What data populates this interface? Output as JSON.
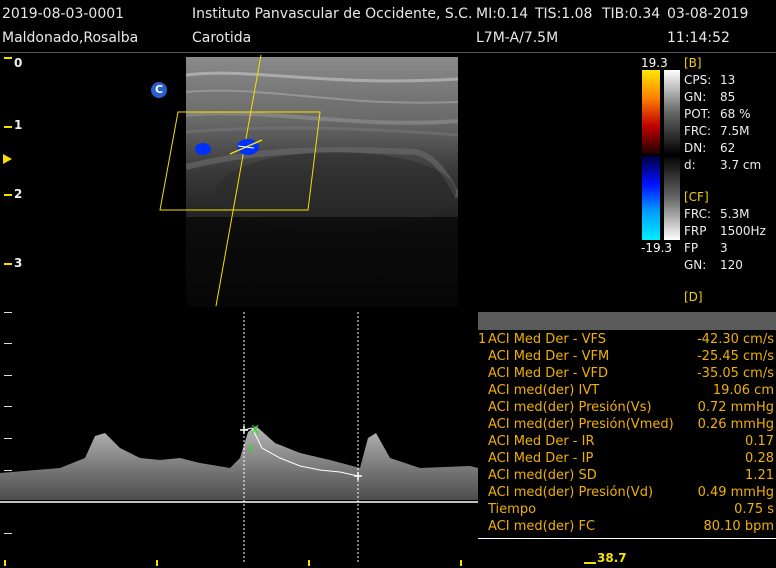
{
  "header": {
    "patient_id": "2019-08-03-0001",
    "institution": "Instituto Panvascular de Occidente, S.C.",
    "mi": "MI:0.14",
    "tis": "TIS:1.08",
    "tib": "TIB:0.34",
    "date": "03-08-2019",
    "patient_name": "Maldonado,Rosalba",
    "exam": "Carotida",
    "probe": "L7M-A/7.5M",
    "time": "11:14:52"
  },
  "depth_scale": [
    "0",
    "1",
    "2",
    "3"
  ],
  "probe_marker": "C",
  "color_bar": {
    "max": "19.3",
    "min": "-19.3"
  },
  "params_b": {
    "title": "[B]",
    "rows": [
      {
        "k": "CPS:",
        "v": "13"
      },
      {
        "k": "GN:",
        "v": "85"
      },
      {
        "k": "POT:",
        "v": "68 %"
      },
      {
        "k": "FRC:",
        "v": "7.5M"
      },
      {
        "k": "DN:",
        "v": "62"
      },
      {
        "k": "d:",
        "v": "3.7 cm"
      }
    ]
  },
  "params_cf": {
    "title": "[CF]",
    "rows": [
      {
        "k": "FRC:",
        "v": "5.3M"
      },
      {
        "k": "FRP",
        "v": "1500Hz"
      },
      {
        "k": "FP",
        "v": "3"
      },
      {
        "k": "GN:",
        "v": "120"
      }
    ]
  },
  "params_d": {
    "title": "[D]"
  },
  "measurements": [
    {
      "num": "1",
      "label": "ACI Med Der - VFS",
      "value": "-42.30 cm/s"
    },
    {
      "num": "",
      "label": "ACI Med Der - VFM",
      "value": "-25.45 cm/s"
    },
    {
      "num": "",
      "label": "ACI Med Der - VFD",
      "value": "-35.05 cm/s"
    },
    {
      "num": "",
      "label": "ACI med(der) IVT",
      "value": "19.06 cm"
    },
    {
      "num": "",
      "label": "ACI med(der) Presión(Vs)",
      "value": "0.72 mmHg"
    },
    {
      "num": "",
      "label": "ACI med(der) Presión(Vmed)",
      "value": "0.26 mmHg"
    },
    {
      "num": "",
      "label": "ACI Med Der - IR",
      "value": "0.17"
    },
    {
      "num": "",
      "label": "ACI Med Der - IP",
      "value": "0.28"
    },
    {
      "num": "",
      "label": "ACI med(der) SD",
      "value": "1.21"
    },
    {
      "num": "",
      "label": "ACI med(der) Presión(Vd)",
      "value": "0.49 mmHg"
    },
    {
      "num": "",
      "label": "Tiempo",
      "value": "0.75 s"
    },
    {
      "num": "",
      "label": "ACI med(der) FC",
      "value": "80.10 bpm"
    }
  ],
  "bottom_readout": "38.7",
  "colors": {
    "accent_yellow": "#f5e000",
    "measure_orange": "#f0b000",
    "flow_blue": "#0030ff"
  }
}
